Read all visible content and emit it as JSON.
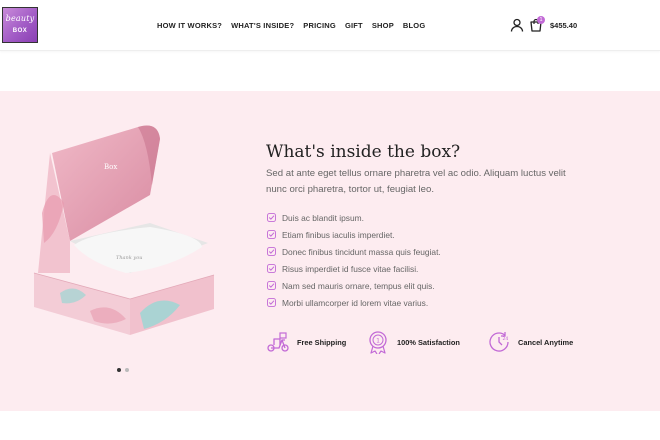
{
  "brand": {
    "logo_script": "beauty",
    "logo_box": "BOX"
  },
  "nav": {
    "items": [
      "HOW IT WORKS?",
      "WHAT'S INSIDE?",
      "PRICING",
      "GIFT",
      "SHOP",
      "BLOG"
    ]
  },
  "header": {
    "cart_count": "1",
    "cart_total": "$455.40"
  },
  "hero": {
    "title": "What's inside the box?",
    "description": "Sed at ante eget tellus ornare pharetra vel ac odio. Aliquam luctus velit nunc orci pharetra, tortor ut, feugiat leo.",
    "box_lid_label": "Box",
    "box_card_label": "Thank you",
    "list": [
      "Duis ac blandit ipsum.",
      "Etiam finibus iaculis imperdiet.",
      "Donec finibus tincidunt massa quis feugiat.",
      "Risus imperdiet id fusce vitae facilisi.",
      "Nam sed mauris ornare, tempus elit quis.",
      "Morbi ullamcorper id lorem vitae varius."
    ],
    "features": [
      {
        "label": "Free Shipping",
        "icon": "scooter-icon"
      },
      {
        "label": "100% Satisfaction",
        "icon": "award-medal-icon"
      },
      {
        "label": "Cancel Anytime",
        "icon": "clock-24-icon"
      }
    ],
    "slider_dots": 2,
    "active_dot": 0
  },
  "colors": {
    "accent": "#c26ad6",
    "hero_bg": "#fdecf0",
    "box_pink": "#e9a3b6"
  }
}
